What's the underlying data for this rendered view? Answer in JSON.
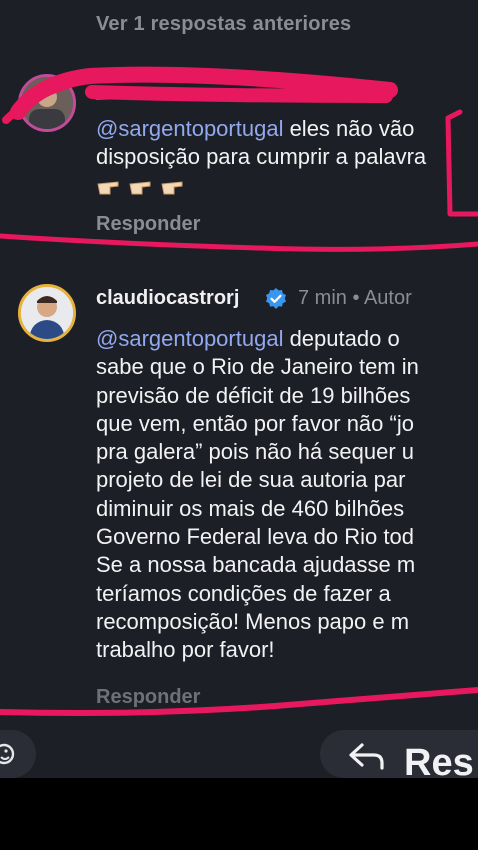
{
  "thread": {
    "previous_replies_link": "Ver 1 respostas anteriores"
  },
  "comment1": {
    "username": "______",
    "mention": "@sargentoportugal",
    "text_line1": " eles não vão",
    "text_line2": "disposição para cumprir a palavra",
    "emoji": "👉👉👉",
    "reply_label": "Responder"
  },
  "comment2": {
    "username": "claudiocastrorj",
    "verified": true,
    "time": "7 min",
    "separator": "•",
    "author_badge": "Autor",
    "mention": "@sargentoportugal",
    "lines": [
      " deputado o",
      "sabe que o Rio de Janeiro tem in",
      "previsão de déficit de 19 bilhões",
      "que vem, então por favor não “jo",
      "pra galera” pois não há sequer u",
      "projeto de lei de sua autoria par",
      "diminuir os mais de 460 bilhões",
      "Governo Federal leva do Rio tod",
      "Se a nossa bancada ajudasse m",
      "teríamos condições de fazer a",
      "recomposição! Menos papo e m",
      "trabalho por favor!"
    ],
    "reply_label": "Responder"
  },
  "bottom_bar": {
    "reply_back_label": "Res",
    "reply_back_icon": "reply-arrow-icon",
    "emoji_icon": "emoji-icon"
  },
  "colors": {
    "background": "#1d1f26",
    "mention": "#92a8ef",
    "annotation": "#e8185e",
    "verified": "#3797f0"
  }
}
